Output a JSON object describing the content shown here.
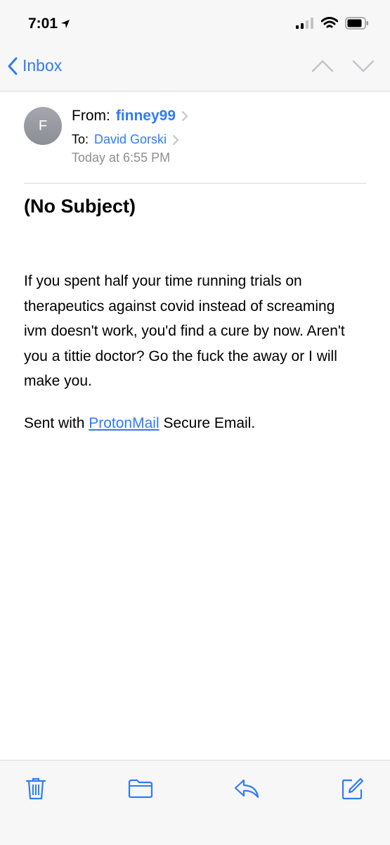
{
  "status_bar": {
    "time": "7:01"
  },
  "nav": {
    "back_label": "Inbox"
  },
  "message": {
    "avatar_initial": "F",
    "from_label": "From:",
    "from_name": "finney99",
    "to_label": "To:",
    "to_name": "David Gorski",
    "date": "Today at 6:55 PM",
    "subject": "(No Subject)",
    "body": "If you spent half your time running trials on therapeutics against covid instead of screaming ivm doesn't work, you'd find a cure by now. Aren't you a tittie doctor? Go the fuck the away or I will make you.",
    "signature_prefix": "Sent with",
    "signature_link": "ProtonMail",
    "signature_suffix": "Secure Email."
  },
  "toolbar": {
    "icons": [
      "trash-icon",
      "folder-icon",
      "reply-icon",
      "compose-icon"
    ]
  },
  "colors": {
    "accent": "#2f7cf6",
    "secondary_text": "#8e8e93",
    "bar_background": "#f7f7f7"
  }
}
